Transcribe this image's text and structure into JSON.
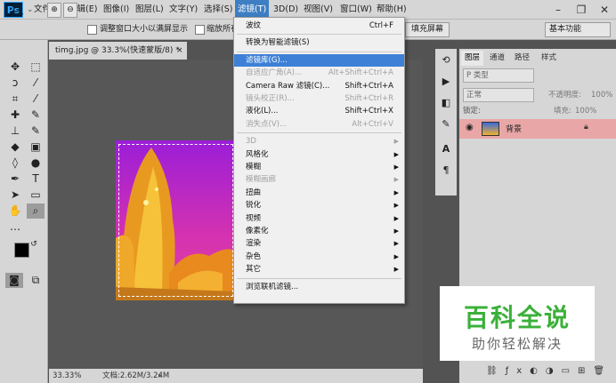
{
  "app": {
    "logo": "Ps"
  },
  "menubar": {
    "items": [
      "文件(F)",
      "编辑(E)",
      "图像(I)",
      "图层(L)",
      "文字(Y)",
      "选择(S)",
      "滤镜(T)",
      "3D(D)",
      "视图(V)",
      "窗口(W)",
      "帮助(H)"
    ],
    "active_index": 6
  },
  "window_controls": {
    "minimize": "–",
    "restore": "❐",
    "close": "✕"
  },
  "options_bar": {
    "fit_window_label": "调整窗口大小以满屏显示",
    "zoom_all_label": "缩放所有",
    "fill_screen_label": "填充屏幕",
    "workspace": "基本功能"
  },
  "document": {
    "tab_title": "timg.jpg @ 33.3%(快速蒙版/8) *",
    "zoom": "33.33%",
    "doc_size": "文档:2.62M/3.24M"
  },
  "filter_menu": {
    "items": [
      {
        "label": "波纹",
        "shortcut": "Ctrl+F",
        "state": "normal"
      },
      {
        "sep": true
      },
      {
        "label": "转换为智能滤镜(S)",
        "state": "normal"
      },
      {
        "sep": true
      },
      {
        "label": "滤镜库(G)...",
        "state": "highlight"
      },
      {
        "label": "自适应广角(A)...",
        "shortcut": "Alt+Shift+Ctrl+A",
        "state": "disabled"
      },
      {
        "label": "Camera Raw 滤镜(C)...",
        "shortcut": "Shift+Ctrl+A",
        "state": "normal"
      },
      {
        "label": "镜头校正(R)...",
        "shortcut": "Shift+Ctrl+R",
        "state": "disabled"
      },
      {
        "label": "液化(L)...",
        "shortcut": "Shift+Ctrl+X",
        "state": "normal"
      },
      {
        "label": "消失点(V)...",
        "shortcut": "Alt+Ctrl+V",
        "state": "disabled"
      },
      {
        "sep": true
      },
      {
        "label": "3D",
        "submenu": true,
        "state": "disabled"
      },
      {
        "label": "风格化",
        "submenu": true,
        "state": "normal"
      },
      {
        "label": "模糊",
        "submenu": true,
        "state": "normal"
      },
      {
        "label": "模糊画廊",
        "submenu": true,
        "state": "disabled"
      },
      {
        "label": "扭曲",
        "submenu": true,
        "state": "normal"
      },
      {
        "label": "锐化",
        "submenu": true,
        "state": "normal"
      },
      {
        "label": "视频",
        "submenu": true,
        "state": "normal"
      },
      {
        "label": "像素化",
        "submenu": true,
        "state": "normal"
      },
      {
        "label": "渲染",
        "submenu": true,
        "state": "normal"
      },
      {
        "label": "杂色",
        "submenu": true,
        "state": "normal"
      },
      {
        "label": "其它",
        "submenu": true,
        "state": "normal"
      },
      {
        "sep": true
      },
      {
        "label": "浏览联机滤镜...",
        "state": "normal"
      }
    ]
  },
  "panel": {
    "tabs": [
      "图层",
      "通道",
      "路径",
      "样式"
    ],
    "kind_filter": "P 类型",
    "blend_mode": "正常",
    "opacity_label": "不透明度:",
    "opacity_value": "100%",
    "lock_label": "锁定:",
    "fill_label": "填充:",
    "fill_value": "100%",
    "layer_name": "背景"
  },
  "watermark": {
    "title": "百科全说",
    "subtitle": "助你轻松解决"
  },
  "colors": {
    "accent": "#3e80d6",
    "layer_highlight": "#e8a6a6",
    "watermark_green": "#3bb03a"
  }
}
